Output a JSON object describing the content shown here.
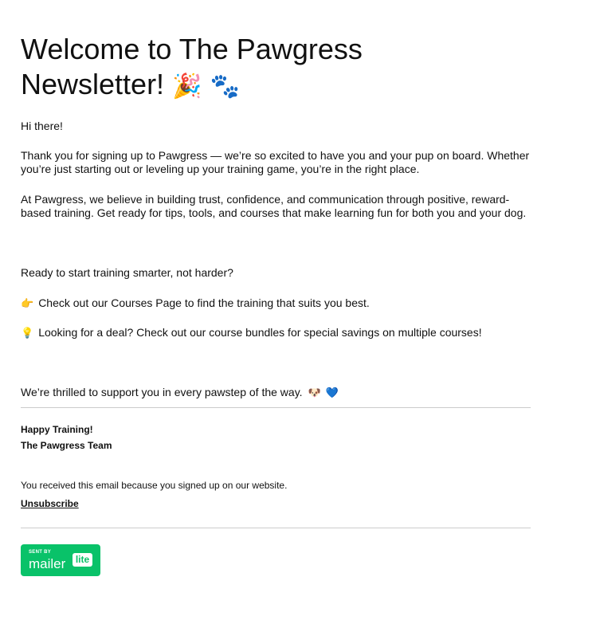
{
  "email": {
    "title_line1": "Welcome to The Pawgress",
    "title_line2": "Newsletter!",
    "title_emoji_party": "🎉",
    "title_emoji_paws": "🐾",
    "greeting": "Hi there!",
    "para1": "Thank you for signing up to Pawgress — we’re so excited to have you and your pup on board. Whether you’re just starting out or leveling up your training game, you’re in the right place.",
    "para2": "At Pawgress, we believe in building trust, confidence, and communication through positive, reward-based training. Get ready for tips, tools, and courses that make learning fun for both you and your dog.",
    "ready": "Ready to start training smarter, not harder?",
    "courses_emoji": "👉",
    "courses": "Check out our Courses Page to find the training that suits you best.",
    "deal_emoji": "💡",
    "deal": "Looking for a deal? Check out our course bundles for special savings on multiple courses!",
    "thrilled": "We’re thrilled to support you in every pawstep of the way.",
    "thrilled_emoji_dog": "🐶",
    "thrilled_emoji_heart": "💙",
    "signoff1": "Happy Training!",
    "signoff2": "The Pawgress Team",
    "footer_note": "You received this email because you signed up on our website.",
    "unsubscribe": "Unsubscribe"
  },
  "badge": {
    "sent_by": "SENT BY",
    "mailer": "mailer",
    "lite": "lite",
    "color": "#09c269"
  }
}
